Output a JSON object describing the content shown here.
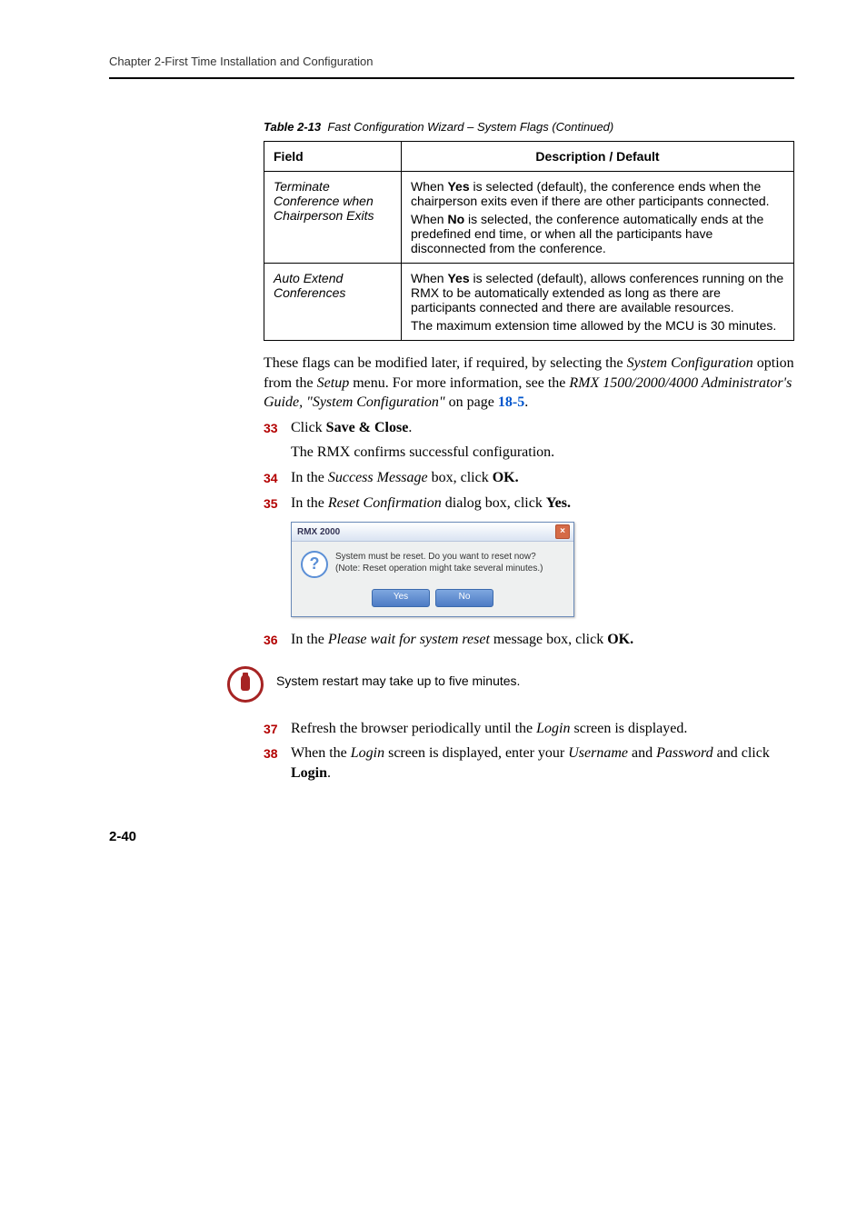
{
  "header": {
    "running": "Chapter 2-First Time Installation and Configuration"
  },
  "table": {
    "caption_label": "Table 2-13",
    "caption_text": "Fast Configuration Wizard – System Flags (Continued)",
    "head_field": "Field",
    "head_desc": "Description / Default",
    "rows": [
      {
        "field": "Terminate Conference when Chairperson Exits",
        "desc_p1a": "When ",
        "desc_p1b": "Yes",
        "desc_p1c": " is selected (default), the conference ends when the chairperson exits even if there are other participants connected.",
        "desc_p2a": "When ",
        "desc_p2b": "No",
        "desc_p2c": " is selected, the conference automatically ends at the predefined end time, or when all the participants have disconnected from the conference."
      },
      {
        "field": "Auto Extend Conferences",
        "desc_p1a": "When ",
        "desc_p1b": "Yes",
        "desc_p1c": " is selected (default), allows conferences running on the RMX to be automatically extended as long as there are participants connected and there are available resources.",
        "desc_p2": "The maximum extension time allowed by the MCU is 30 minutes."
      }
    ]
  },
  "body": {
    "para1a": "These flags can be modified later, if required, by selecting the ",
    "para1b": "System Configuration",
    "para1c": " option from the ",
    "para1d": "Setup",
    "para1e": " menu. For more information, see the ",
    "para1f": "RMX 1500/2000/4000 Administrator's Guide, \"System Configuration\"",
    "para1g": " on page ",
    "para1h": "18-5",
    "para1i": "."
  },
  "steps": {
    "s33": {
      "num": "33",
      "a": "Click ",
      "b": "Save & Close",
      "c": "."
    },
    "s33sub": "The RMX confirms successful configuration.",
    "s34": {
      "num": "34",
      "a": "In the ",
      "b": "Success Message",
      "c": " box, click ",
      "d": "OK."
    },
    "s35": {
      "num": "35",
      "a": "In the ",
      "b": "Reset Confirmation",
      "c": " dialog box, click ",
      "d": "Yes."
    },
    "s36": {
      "num": "36",
      "a": "In the ",
      "b": "Please wait for system reset",
      "c": " message box, click ",
      "d": "OK."
    },
    "s37": {
      "num": "37",
      "a": "Refresh the browser periodically until the ",
      "b": "Login",
      "c": " screen is displayed."
    },
    "s38": {
      "num": "38",
      "a": "When the ",
      "b": "Login",
      "c": " screen is displayed, enter your ",
      "d": "Username",
      "e": " and ",
      "f": "Password",
      "g": " and click ",
      "h": "Login",
      "i": "."
    }
  },
  "dialog": {
    "title": "RMX 2000",
    "line1": "System must be reset. Do you want to reset now?",
    "line2": "(Note: Reset operation might take several minutes.)",
    "yes": "Yes",
    "no": "No"
  },
  "note": {
    "text": "System restart may take up to five minutes."
  },
  "pagenum": "2-40"
}
